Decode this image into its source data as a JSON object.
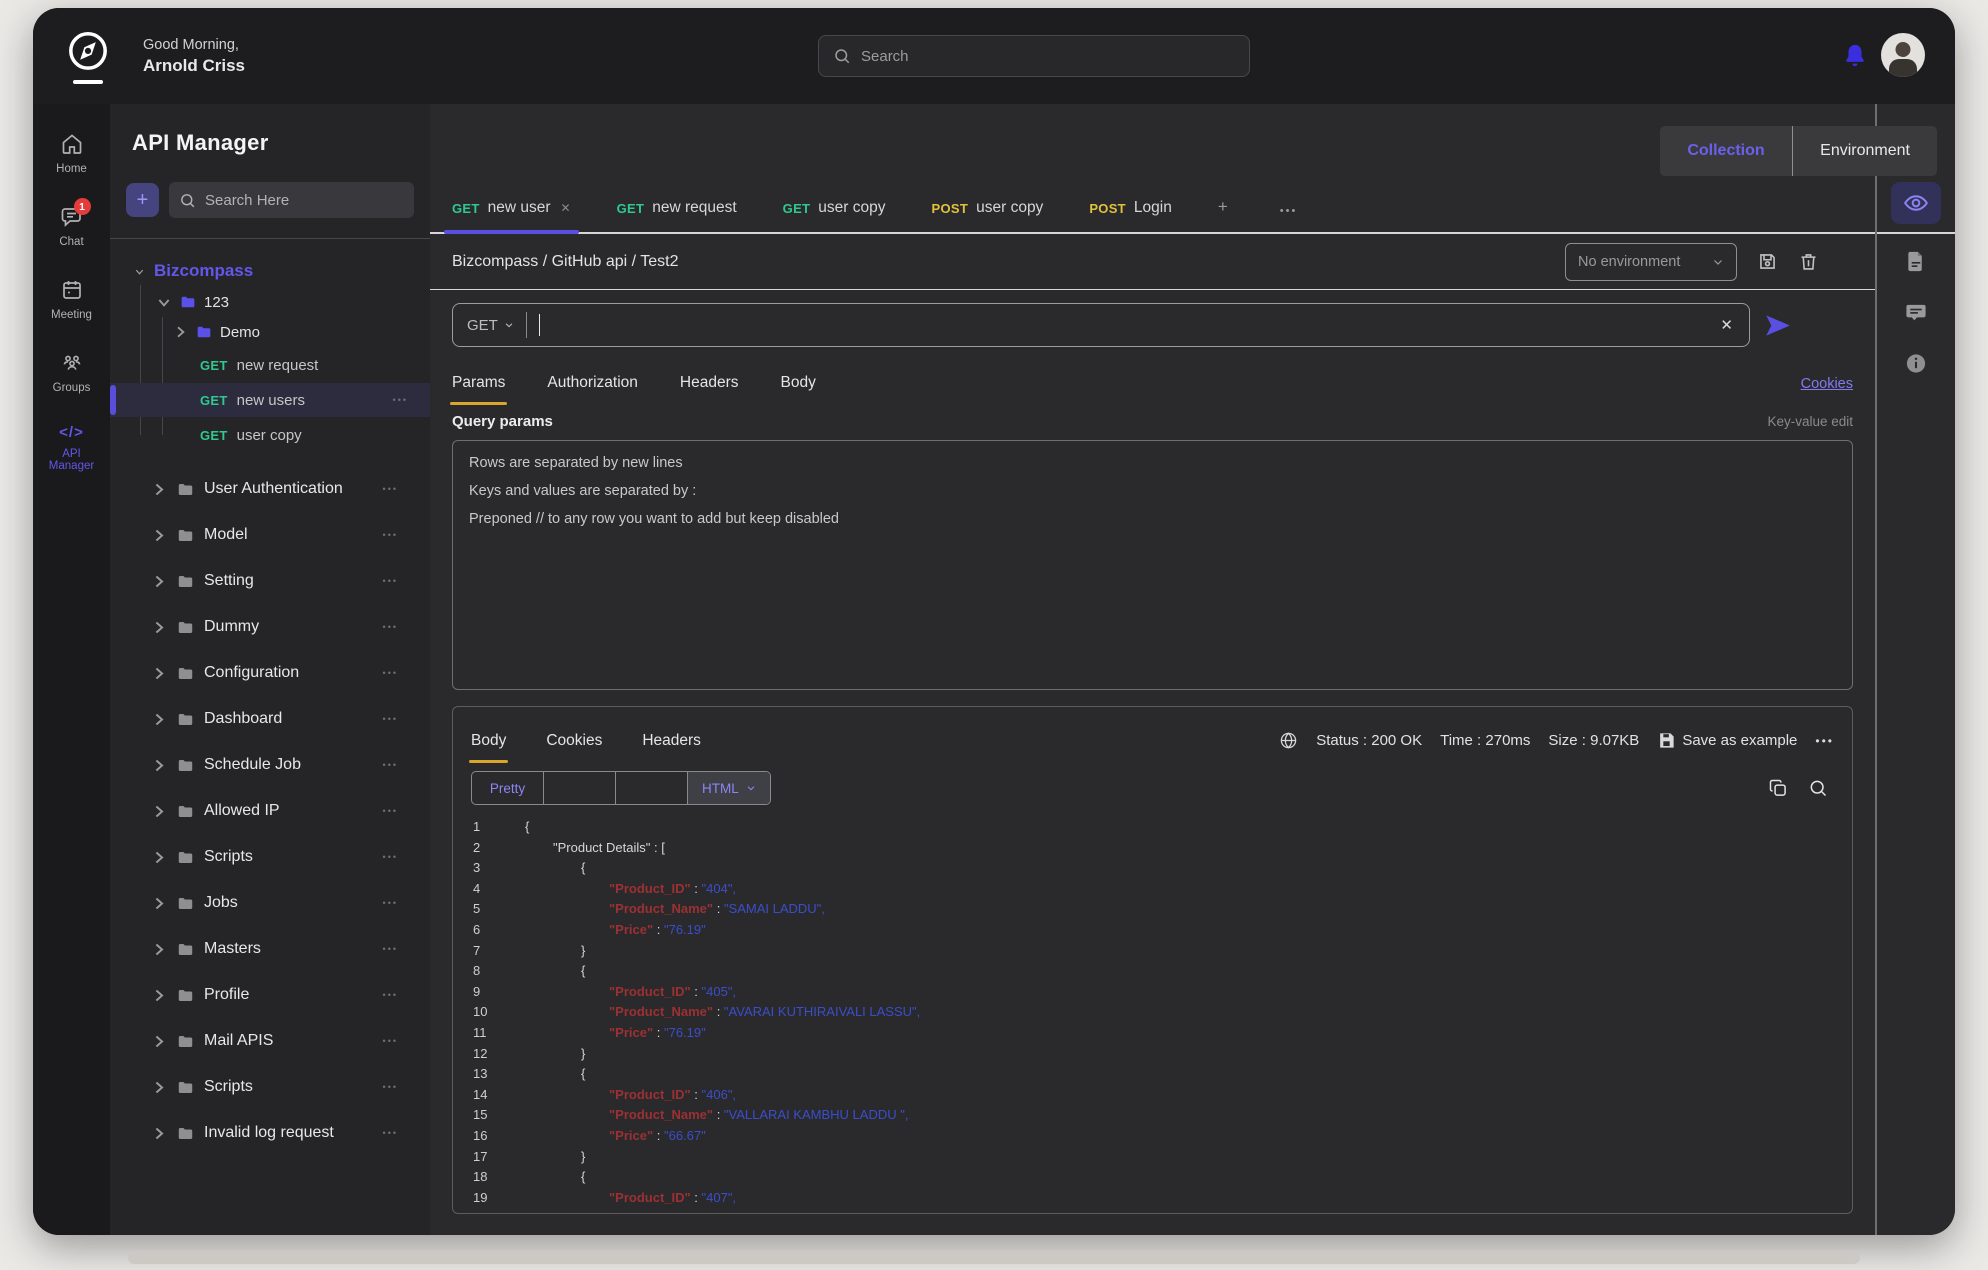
{
  "header": {
    "greeting": "Good Morning,",
    "username": "Arnold Criss",
    "search_placeholder": "Search"
  },
  "nav_rail": {
    "items": [
      {
        "label": "Home",
        "icon": "home"
      },
      {
        "label": "Chat",
        "icon": "chat",
        "badge": "1"
      },
      {
        "label": "Meeting",
        "icon": "calendar"
      },
      {
        "label": "Groups",
        "icon": "groups"
      },
      {
        "label": "API Manager",
        "icon": "code",
        "active": true
      }
    ]
  },
  "sidebar": {
    "title": "API Manager",
    "add_label": "+",
    "search_placeholder": "Search Here",
    "tree": {
      "root": "Bizcompass",
      "folder_level1": "123",
      "folder_level2": "Demo",
      "requests": [
        {
          "method": "GET",
          "label": "new request"
        },
        {
          "method": "GET",
          "label": "new users",
          "active": true
        },
        {
          "method": "GET",
          "label": "user copy"
        }
      ],
      "folders": [
        "User Authentication",
        "Model",
        "Setting",
        "Dummy",
        "Configuration",
        "Dashboard",
        "Schedule Job",
        "Allowed IP",
        "Scripts",
        "Jobs",
        "Masters",
        "Profile",
        "Mail APIS",
        "Scripts",
        "Invalid log request"
      ]
    }
  },
  "workspace_switch": {
    "collection": "Collection",
    "environment": "Environment"
  },
  "request_tabs": [
    {
      "method": "GET",
      "label": "new user",
      "active": true,
      "closable": true
    },
    {
      "method": "GET",
      "label": "new request"
    },
    {
      "method": "GET",
      "label": "user copy"
    },
    {
      "method": "POST",
      "label": "user copy"
    },
    {
      "method": "POST",
      "label": "Login"
    }
  ],
  "tabs_add_label": "+",
  "tabs_more_label": "•••",
  "request": {
    "breadcrumb": "Bizcompass / GitHub api / Test2",
    "environment_select": "No environment",
    "method": "GET",
    "url_value": "",
    "clear_label": "✕",
    "tabs": [
      "Params",
      "Authorization",
      "Headers",
      "Body"
    ],
    "cookies_link": "Cookies",
    "query_params_label": "Query params",
    "key_value_edit_label": "Key-value edit",
    "placeholder_lines": [
      "Rows are separated by new lines",
      "Keys and values are separated by :",
      "Preponed // to any row you want to add but keep disabled"
    ]
  },
  "response": {
    "tabs": [
      "Body",
      "Cookies",
      "Headers"
    ],
    "status": "Status : 200 OK",
    "time": "Time : 270ms",
    "size": "Size : 9.07KB",
    "save_as_example": "Save as example",
    "more_label": "•••",
    "toolbar": {
      "segments": [
        "Pretty",
        "",
        ""
      ],
      "format": "HTML"
    },
    "code_lines": [
      {
        "n": "1",
        "i": 0,
        "t": [
          [
            "p",
            "{"
          ]
        ]
      },
      {
        "n": "2",
        "i": 1,
        "t": [
          [
            "p",
            "\"Product Details\" : ["
          ]
        ]
      },
      {
        "n": "3",
        "i": 2,
        "t": [
          [
            "p",
            "{"
          ]
        ]
      },
      {
        "n": "4",
        "i": 3,
        "t": [
          [
            "k",
            "\"Product_ID\""
          ],
          [
            "p",
            " : "
          ],
          [
            "v",
            "\"404\","
          ]
        ]
      },
      {
        "n": "5",
        "i": 3,
        "t": [
          [
            "k",
            "\"Product_Name\""
          ],
          [
            "p",
            " : "
          ],
          [
            "v",
            "\"SAMAI LADDU\","
          ]
        ]
      },
      {
        "n": "6",
        "i": 3,
        "t": [
          [
            "k",
            "\"Price\""
          ],
          [
            "p",
            " : "
          ],
          [
            "v",
            "\"76.19\""
          ]
        ]
      },
      {
        "n": "7",
        "i": 2,
        "t": [
          [
            "p",
            "}"
          ]
        ]
      },
      {
        "n": "8",
        "i": 2,
        "t": [
          [
            "p",
            "{"
          ]
        ]
      },
      {
        "n": "9",
        "i": 3,
        "t": [
          [
            "k",
            "\"Product_ID\""
          ],
          [
            "p",
            " : "
          ],
          [
            "v",
            "\"405\","
          ]
        ]
      },
      {
        "n": "10",
        "i": 3,
        "t": [
          [
            "k",
            "\"Product_Name\""
          ],
          [
            "p",
            " : "
          ],
          [
            "v",
            "\"AVARAI KUTHIRAIVALI LASSU\","
          ]
        ]
      },
      {
        "n": "11",
        "i": 3,
        "t": [
          [
            "k",
            "\"Price\""
          ],
          [
            "p",
            " : "
          ],
          [
            "v",
            "\"76.19\""
          ]
        ]
      },
      {
        "n": "12",
        "i": 2,
        "t": [
          [
            "p",
            "}"
          ]
        ]
      },
      {
        "n": "13",
        "i": 2,
        "t": [
          [
            "p",
            "{"
          ]
        ]
      },
      {
        "n": "14",
        "i": 3,
        "t": [
          [
            "k",
            "\"Product_ID\""
          ],
          [
            "p",
            " : "
          ],
          [
            "v",
            "\"406\","
          ]
        ]
      },
      {
        "n": "15",
        "i": 3,
        "t": [
          [
            "k",
            "\"Product_Name\""
          ],
          [
            "p",
            " : "
          ],
          [
            "v",
            "\"VALLARAI KAMBHU LADDU \","
          ]
        ]
      },
      {
        "n": "16",
        "i": 3,
        "t": [
          [
            "k",
            "\"Price\""
          ],
          [
            "p",
            " : "
          ],
          [
            "v",
            "\"66.67\""
          ]
        ]
      },
      {
        "n": "17",
        "i": 2,
        "t": [
          [
            "p",
            "}"
          ]
        ]
      },
      {
        "n": "18",
        "i": 2,
        "t": [
          [
            "p",
            "{"
          ]
        ]
      },
      {
        "n": "19",
        "i": 3,
        "t": [
          [
            "k",
            "\"Product_ID\""
          ],
          [
            "p",
            " : "
          ],
          [
            "v",
            "\"407\","
          ]
        ]
      }
    ]
  },
  "colors": {
    "accent_indigo": "#5a4fe0",
    "get_green": "#2fc98f",
    "post_yellow": "#e2c13d",
    "active_tab_amber": "#d7a62b",
    "badge_red": "#e53b3b",
    "code_key": "#9c3032",
    "code_value": "#3b4ec9"
  }
}
